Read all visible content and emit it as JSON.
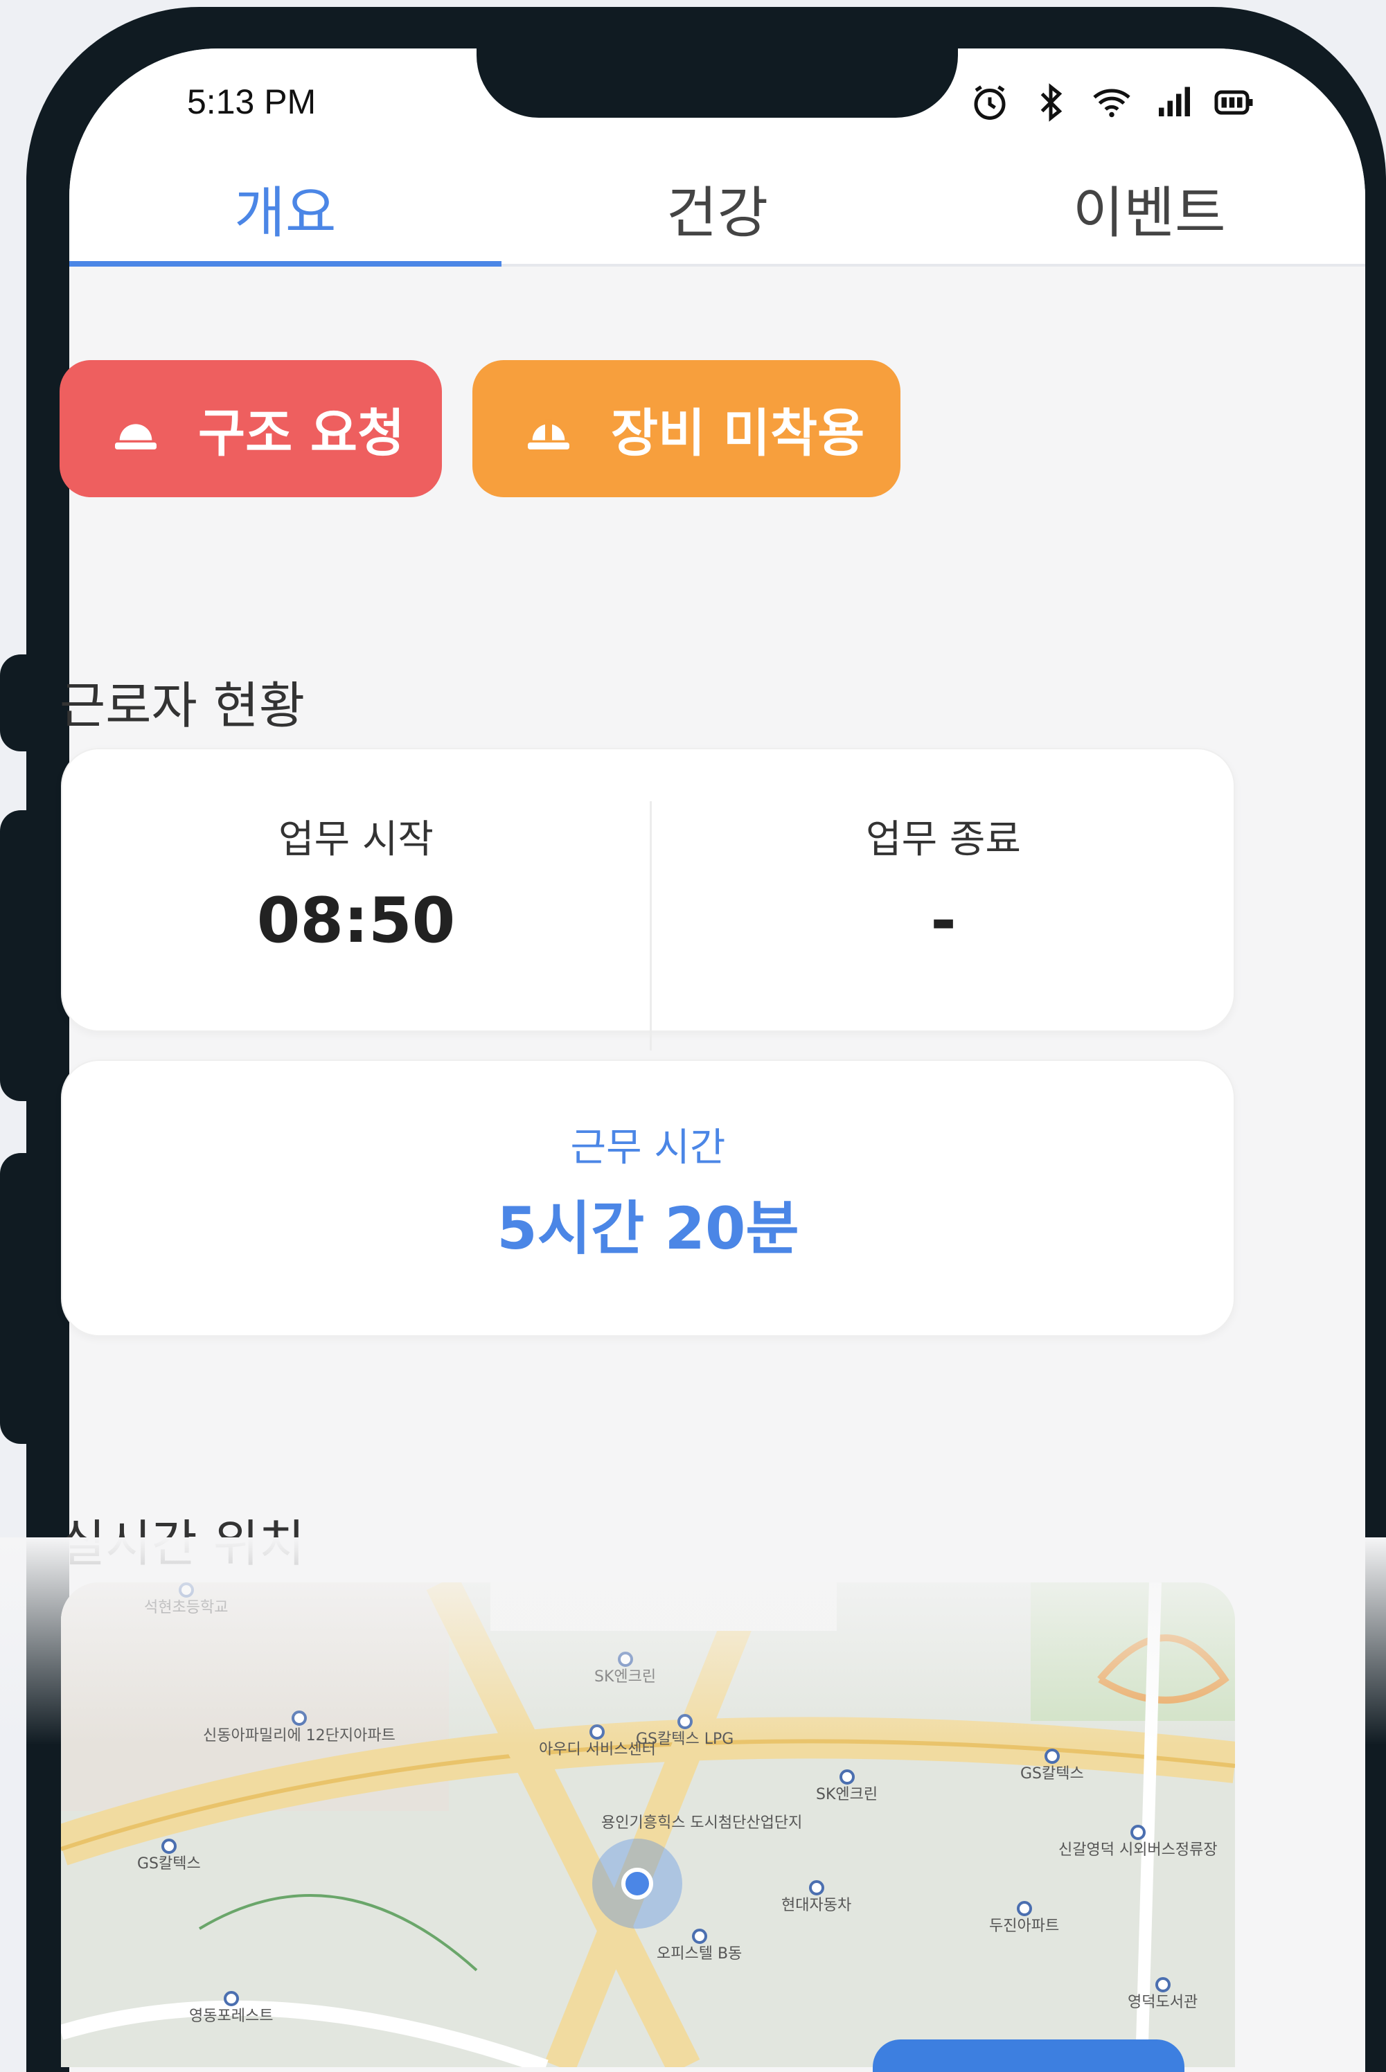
{
  "status_bar": {
    "time": "5:13 PM"
  },
  "tabs": [
    {
      "label": "개요",
      "active": true
    },
    {
      "label": "건강",
      "active": false
    },
    {
      "label": "이벤트",
      "active": false
    }
  ],
  "alerts": {
    "rescue_label": "구조 요청",
    "equipment_label": "장비 미착용"
  },
  "worker_status": {
    "title": "근로자 현황",
    "start_label": "업무 시작",
    "start_value": "08:50",
    "end_label": "업무 종료",
    "end_value": "-",
    "work_time_label": "근무 시간",
    "work_time_value": "5시간 20분"
  },
  "location": {
    "title": "실시간 위치",
    "pois": [
      "석현초등학교",
      "신동아파밀리에 12단지아파트",
      "SK엔크린",
      "아우디 서비스센터",
      "GS칼텍스 LPG",
      "SK엔크린",
      "GS칼텍스",
      "용인기흥힉스 도시첨단산업단지",
      "GS칼텍스",
      "신갈영덕 시외버스정류장",
      "현대자동차",
      "두진아파트",
      "오피스텔 B동",
      "영동포레스트",
      "영덕도서관"
    ]
  },
  "colors": {
    "accent": "#4b86e6",
    "rescue": "#ee5f5f",
    "equipment": "#f79f3d"
  }
}
